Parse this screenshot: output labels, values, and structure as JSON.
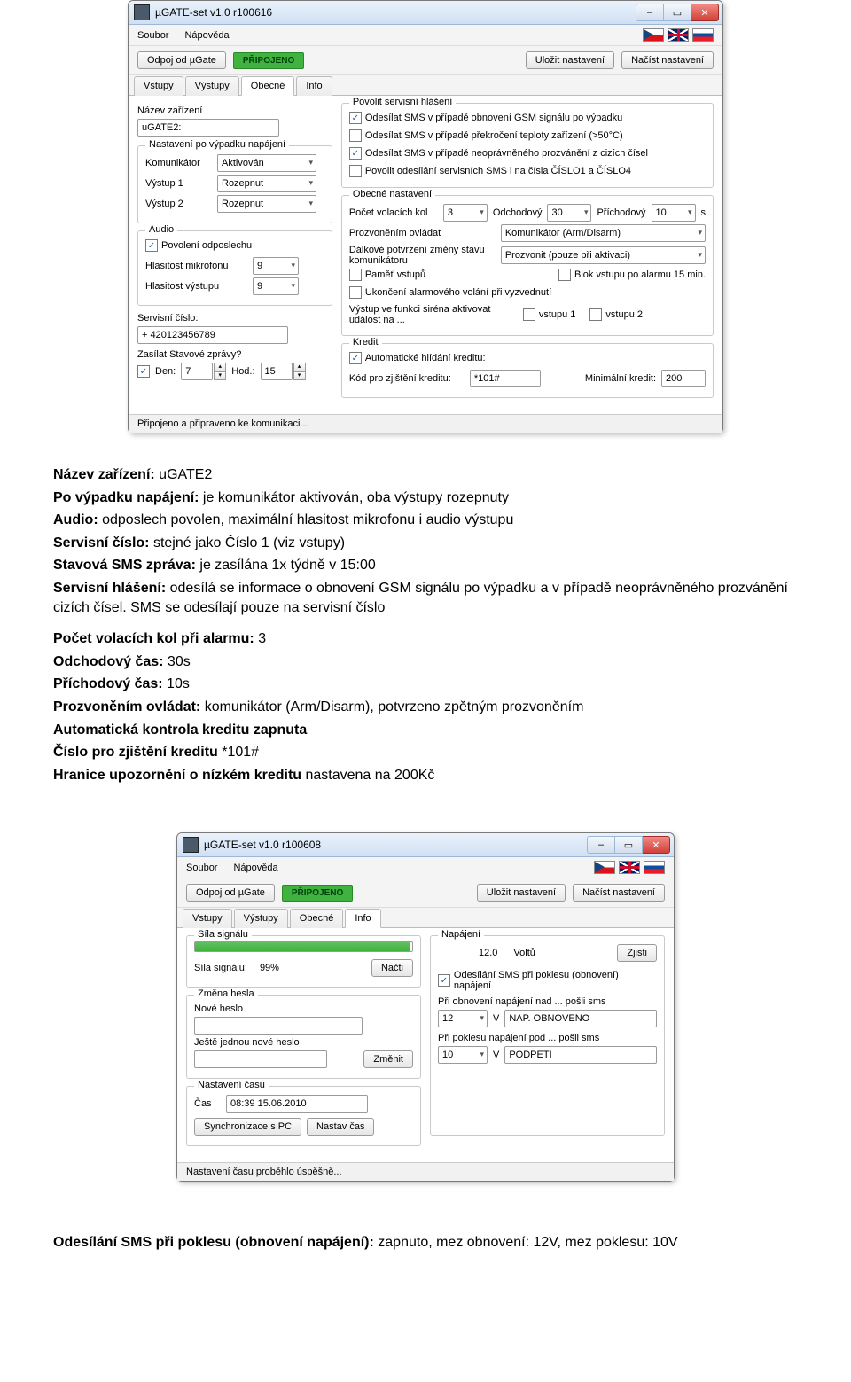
{
  "win1": {
    "title": "µGATE-set v1.0 r100616",
    "menu": {
      "file": "Soubor",
      "help": "Nápověda"
    },
    "toolbar": {
      "disconnect": "Odpoj od µGate",
      "status": "PŘIPOJENO",
      "save": "Uložit nastavení",
      "load": "Načíst nastavení"
    },
    "tabs": {
      "t1": "Vstupy",
      "t2": "Výstupy",
      "t3": "Obecné",
      "t4": "Info"
    },
    "left": {
      "name_label": "Název zařízení",
      "name_value": "uGATE2:",
      "after_pwr_legend": "Nastavení po výpadku napájení",
      "komunikator_label": "Komunikátor",
      "komunikator_value": "Aktivován",
      "out1_label": "Výstup 1",
      "out1_value": "Rozepnut",
      "out2_label": "Výstup 2",
      "out2_value": "Rozepnut",
      "audio_legend": "Audio",
      "listen_label": "Povolení odposlechu",
      "mic_label": "Hlasitost mikrofonu",
      "mic_value": "9",
      "out_vol_label": "Hlasitost výstupu",
      "out_vol_value": "9",
      "service_label": "Servisní číslo:",
      "service_value": "+   420123456789",
      "status_rep_label": "Zasílat Stavové zprávy?",
      "day_label": "Den:",
      "day_value": "7",
      "hour_label": "Hod.:",
      "hour_value": "15"
    },
    "right": {
      "alerts_legend": "Povolit servisní hlášení",
      "alert_gsm": "Odesílat SMS v případě obnovení GSM signálu po výpadku",
      "alert_temp": "Odesílat SMS v případě překročení teploty zařízení (>50°C)",
      "alert_ring": "Odesílat SMS v případě neoprávněného prozvánění z cizích čísel",
      "alert_numbers": "Povolit odesílání servisních SMS i na čísla ČÍSLO1 a ČÍSLO4",
      "general_legend": "Obecné nastavení",
      "calls_label": "Počet volacích kol",
      "calls_value": "3",
      "leave_label": "Odchodový",
      "leave_value": "30",
      "arrive_label": "Příchodový",
      "arrive_value": "10",
      "seconds": "s",
      "ring_ctl_label": "Prozvoněním ovládat",
      "ring_ctl_value": "Komunikátor (Arm/Disarm)",
      "remote_conf_label": "Dálkové potvrzení změny stavu komunikátoru",
      "remote_conf_value": "Prozvonit (pouze při aktivaci)",
      "mem_inputs": "Paměť vstupů",
      "block_input": "Blok vstupu po alarmu 15 min.",
      "end_alarm_call": "Ukončení alarmového volání při vyzvednutí",
      "siren_label": "Výstup ve funkci siréna aktivovat událost na ...",
      "siren_in1": "vstupu 1",
      "siren_in2": "vstupu 2",
      "credit_legend": "Kredit",
      "auto_credit": "Automatické hlídání kreditu:",
      "credit_code_label": "Kód pro zjištění kreditu:",
      "credit_code_value": "*101#",
      "min_credit_label": "Minimální kredit:",
      "min_credit_value": "200"
    },
    "statusbar": "Připojeno a připraveno ke komunikaci..."
  },
  "text1": {
    "l1b": "Název zařízení:",
    "l1": "  uGATE2",
    "l2b": "Po výpadku napájení:",
    "l2": " je komunikátor aktivován, oba výstupy rozepnuty",
    "l3b": "Audio:",
    "l3": " odposlech povolen, maximální hlasitost mikrofonu i audio výstupu",
    "l4b": "Servisní číslo:",
    "l4": " stejné jako Číslo 1 (viz vstupy)",
    "l5b": "Stavová SMS zpráva:",
    "l5": " je zasílána 1x týdně v 15:00",
    "l6b": "Servisní hlášení:",
    "l6": " odesílá se informace o obnovení GSM signálu po výpadku a v případě neoprávněného prozvánění cizích čísel. SMS se odesílají pouze na servisní číslo",
    "l7b": "Počet volacích kol při alarmu:",
    "l7": " 3",
    "l8b": "Odchodový čas:",
    "l8": " 30s",
    "l9b": "Příchodový čas:",
    "l9": " 10s",
    "l10b": "Prozvoněním ovládat:",
    "l10": " komunikátor (Arm/Disarm), potvrzeno zpětným prozvoněním",
    "l11b": "Automatická kontrola kreditu zapnuta",
    "l12b": "Číslo pro zjištění kreditu",
    "l12": " *101#",
    "l13b": "Hranice upozornění o nízkém kreditu",
    "l13": " nastavena na 200Kč"
  },
  "win2": {
    "title": "µGATE-set v1.0 r100608",
    "menu": {
      "file": "Soubor",
      "help": "Nápověda"
    },
    "toolbar": {
      "disconnect": "Odpoj od µGate",
      "status": "PŘIPOJENO",
      "save": "Uložit nastavení",
      "load": "Načíst nastavení"
    },
    "tabs": {
      "t1": "Vstupy",
      "t2": "Výstupy",
      "t3": "Obecné",
      "t4": "Info"
    },
    "signal": {
      "legend": "Síla signálu",
      "label": "Síla signálu:",
      "value": "99%",
      "percent": 99,
      "button": "Načti"
    },
    "pwd": {
      "legend": "Změna hesla",
      "new_label": "Nové heslo",
      "again_label": "Ještě jednou nové heslo",
      "button": "Změnit"
    },
    "time": {
      "legend": "Nastavení času",
      "clock_label": "Čas",
      "clock_value": "08:39 15.06.2010",
      "sync_btn": "Synchronizace s PC",
      "set_btn": "Nastav čas"
    },
    "power": {
      "legend": "Napájení",
      "volt_value": "12.0",
      "volt_unit": "Voltů",
      "measure_btn": "Zjisti",
      "chk_send": "Odesílání SMS při poklesu (obnovení) napájení",
      "above_label": "Při obnovení napájení nad ... pošli sms",
      "above_value": "12",
      "above_sms": "NAP. OBNOVENO",
      "below_label": "Při poklesu napájení pod ... pošli sms",
      "below_value": "10",
      "below_sms": "PODPETI",
      "unitV": "V"
    },
    "statusbar": "Nastavení času proběhlo úspěšně..."
  },
  "text2": {
    "b": "Odesílání SMS při poklesu (obnovení napájení):",
    "rest": " zapnuto, mez obnovení: 12V, mez poklesu: 10V"
  }
}
